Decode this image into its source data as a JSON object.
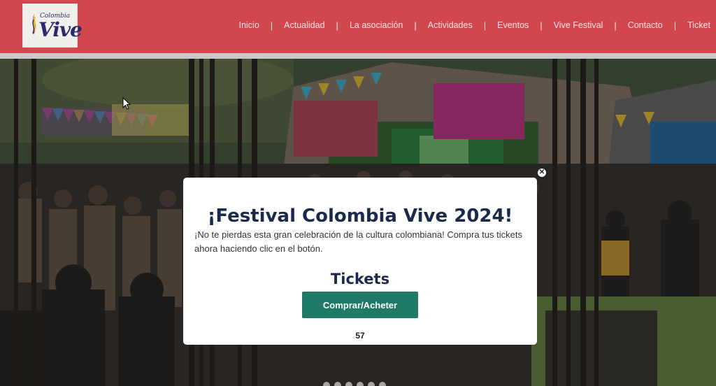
{
  "header": {
    "logo_small": "Colombia",
    "logo_big": "Vive",
    "nav": [
      {
        "label": "Inicio"
      },
      {
        "label": "Actualidad"
      },
      {
        "label": "La asociación"
      },
      {
        "label": "Actividades"
      },
      {
        "label": "Eventos"
      },
      {
        "label": "Vive Festival"
      },
      {
        "label": "Contacto"
      },
      {
        "label": "Ticket"
      }
    ],
    "separator": "|"
  },
  "popup": {
    "title": "¡Festival Colombia Vive 2024!",
    "text": "¡No te pierdas esta gran celebración de la cultura colombiana! Compra tus tickets ahora haciendo clic en el botón.",
    "subtitle": "Tickets",
    "button_label": "Comprar/Acheter",
    "counter": "57",
    "close_icon": "close-icon"
  },
  "colors": {
    "header": "#d2474e",
    "button": "#1f7a68",
    "title": "#1b2a4a"
  }
}
